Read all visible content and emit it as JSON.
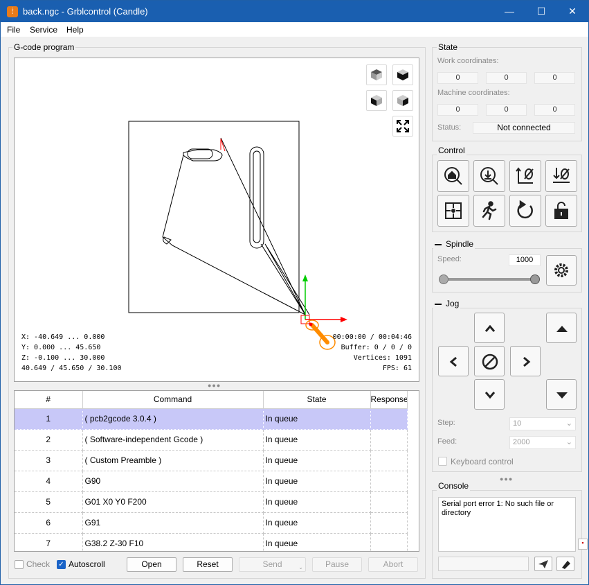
{
  "window": {
    "title": "back.ngc - Grblcontrol  (Candle)",
    "minimize_glyph": "—",
    "maximize_glyph": "☐",
    "close_glyph": "✕",
    "app_icon": "candle-logo-icon"
  },
  "menu": [
    "File",
    "Service",
    "Help"
  ],
  "program": {
    "group_title": "G-code program",
    "info_left": [
      "X: -40.649 ... 0.000",
      "Y: 0.000 ... 45.650",
      "Z: -0.100 ... 30.000",
      "40.649 / 45.650 / 30.100"
    ],
    "info_right": [
      "00:00:00 / 00:04:46",
      "Buffer: 0 / 0 / 0",
      "Vertices: 1091",
      "FPS: 61"
    ],
    "view_buttons": [
      "cube-top-icon",
      "cube-front-icon",
      "cube-left-icon",
      "cube-iso-icon",
      "fit-view-icon"
    ]
  },
  "table": {
    "headers": [
      "#",
      "Command",
      "State",
      "Response"
    ],
    "rows": [
      {
        "num": "1",
        "command": "( pcb2gcode 3.0.4 )",
        "state": "In queue",
        "response": ""
      },
      {
        "num": "2",
        "command": "( Software-independent Gcode )",
        "state": "In queue",
        "response": ""
      },
      {
        "num": "3",
        "command": "( Custom Preamble )",
        "state": "In queue",
        "response": ""
      },
      {
        "num": "4",
        "command": "G90",
        "state": "In queue",
        "response": ""
      },
      {
        "num": "5",
        "command": "G01 X0 Y0 F200",
        "state": "In queue",
        "response": ""
      },
      {
        "num": "6",
        "command": "G91",
        "state": "In queue",
        "response": ""
      },
      {
        "num": "7",
        "command": "G38.2 Z-30 F10",
        "state": "In queue",
        "response": ""
      }
    ],
    "selected_row": "1"
  },
  "bottom": {
    "check_label": "Check",
    "autoscroll_label": "Autoscroll",
    "check_checked": false,
    "autoscroll_checked": true,
    "open": "Open",
    "reset": "Reset",
    "send": "Send",
    "pause": "Pause",
    "abort": "Abort"
  },
  "state": {
    "group_title": "State",
    "work_label": "Work coordinates:",
    "work": [
      "0",
      "0",
      "0"
    ],
    "machine_label": "Machine coordinates:",
    "machine": [
      "0",
      "0",
      "0"
    ],
    "status_label": "Status:",
    "status": "Not connected"
  },
  "control": {
    "group_title": "Control",
    "buttons": [
      "home-icon",
      "probe-z-icon",
      "zero-xy-icon",
      "zero-z-icon",
      "restore-origin-icon",
      "safe-position-icon",
      "reset-icon",
      "unlock-icon"
    ]
  },
  "spindle": {
    "group_title": "Spindle",
    "speed_label": "Speed:",
    "speed_value": "1000",
    "slider_level": 1.0
  },
  "jog": {
    "group_title": "Jog",
    "step_label": "Step:",
    "step_value": "10",
    "feed_label": "Feed:",
    "feed_value": "2000",
    "keyboard_label": "Keyboard control"
  },
  "console": {
    "group_title": "Console",
    "text": "Serial port error 1: No such file or directory",
    "input_placeholder": ""
  },
  "colors": {
    "accent": "#1a5fb0",
    "selected_row": "#c8c8f8",
    "toolpath": "#000000",
    "tool": "#ff8c00",
    "axis_x": "#ff0000",
    "axis_y": "#00cc00"
  }
}
